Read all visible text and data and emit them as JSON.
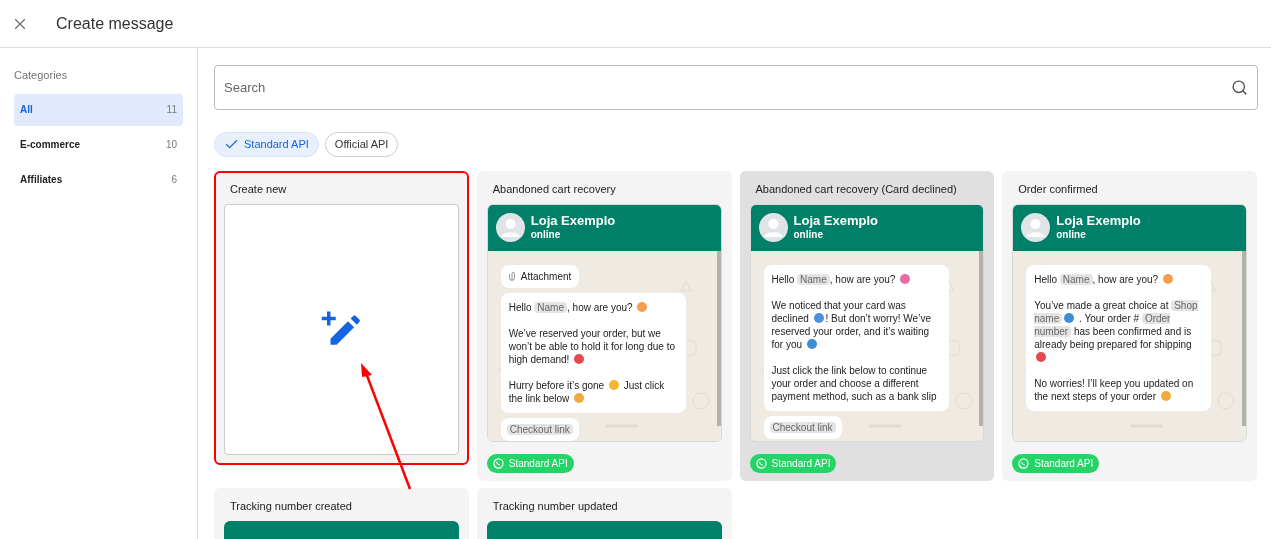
{
  "window": {
    "title": "Create message"
  },
  "sidebar": {
    "heading": "Categories",
    "items": [
      {
        "label": "All",
        "count": "11",
        "selected": true
      },
      {
        "label": "E-commerce",
        "count": "10",
        "selected": false
      },
      {
        "label": "Affiliates",
        "count": "6",
        "selected": false
      }
    ]
  },
  "search": {
    "placeholder": "Search"
  },
  "filters": [
    {
      "label": "Standard API",
      "selected": true
    },
    {
      "label": "Official API",
      "selected": false
    }
  ],
  "cards": [
    {
      "kind": "create",
      "title": "Create new",
      "annotated": true,
      "highlighted": false
    },
    {
      "kind": "template",
      "title": "Abandoned cart recovery",
      "highlighted": false,
      "annotated": false,
      "contact": "Loja Exemplo",
      "status": "online",
      "badge": "Standard API",
      "bubbles": [
        {
          "kind": "attachment",
          "text": "Attachment"
        },
        {
          "kind": "message",
          "paragraphs": [
            [
              {
                "kind": "text",
                "text": "Hello "
              },
              {
                "kind": "chip",
                "text": "Name"
              },
              {
                "kind": "text",
                "text": ", how are you? "
              },
              {
                "kind": "emoji",
                "color": "#f59e52"
              }
            ],
            [
              {
                "kind": "text",
                "text": "We’ve reserved your order, but we won’t be able to hold it for long due to high demand! "
              },
              {
                "kind": "emoji",
                "color": "#e5484d"
              }
            ],
            [
              {
                "kind": "text",
                "text": "Hurry before it’s gone "
              },
              {
                "kind": "emoji",
                "color": "#f2b632"
              },
              {
                "kind": "text",
                "text": " Just click the link below "
              },
              {
                "kind": "emoji",
                "color": "#f2a93b"
              }
            ]
          ]
        },
        {
          "kind": "link",
          "text": "Checkout link"
        }
      ]
    },
    {
      "kind": "template",
      "title": "Abandoned cart recovery (Card declined)",
      "highlighted": true,
      "annotated": false,
      "contact": "Loja Exemplo",
      "status": "online",
      "badge": "Standard API",
      "bubbles": [
        {
          "kind": "message",
          "paragraphs": [
            [
              {
                "kind": "text",
                "text": "Hello "
              },
              {
                "kind": "chip",
                "text": "Name"
              },
              {
                "kind": "text",
                "text": ", how are you? "
              },
              {
                "kind": "emoji",
                "color": "#e86aa8"
              }
            ],
            [
              {
                "kind": "text",
                "text": "We noticed that your card was declined "
              },
              {
                "kind": "emoji",
                "color": "#4f8fe0"
              },
              {
                "kind": "text",
                "text": "! But don’t worry! We’ve reserved your order, and it’s waiting for you "
              },
              {
                "kind": "emoji",
                "color": "#3b8fd9"
              }
            ],
            [
              {
                "kind": "text",
                "text": "Just click the link below to continue your order and choose a different payment method, such as a bank slip"
              }
            ]
          ]
        },
        {
          "kind": "link",
          "text": "Checkout link"
        }
      ]
    },
    {
      "kind": "template",
      "title": "Order confirmed",
      "highlighted": false,
      "annotated": false,
      "contact": "Loja Exemplo",
      "status": "online",
      "badge": "Standard API",
      "bubbles": [
        {
          "kind": "message",
          "paragraphs": [
            [
              {
                "kind": "text",
                "text": "Hello "
              },
              {
                "kind": "chip",
                "text": "Name"
              },
              {
                "kind": "text",
                "text": ", how are you? "
              },
              {
                "kind": "emoji",
                "color": "#f59e52"
              }
            ],
            [
              {
                "kind": "text",
                "text": "You’ve made a great choice at "
              },
              {
                "kind": "chip",
                "text": "Shop name"
              },
              {
                "kind": "emoji",
                "color": "#3b8fd9"
              },
              {
                "kind": "text",
                "text": " . Your order # "
              },
              {
                "kind": "chip",
                "text": "Order number"
              },
              {
                "kind": "text",
                "text": " has been confirmed and is already being prepared for shipping "
              },
              {
                "kind": "emoji",
                "color": "#e5484d"
              }
            ],
            [
              {
                "kind": "text",
                "text": "No worries! I’ll keep you updated on the next steps of your order "
              },
              {
                "kind": "emoji",
                "color": "#f2a93b"
              }
            ]
          ]
        }
      ]
    },
    {
      "kind": "partial",
      "title": "Tracking number created",
      "highlighted": false,
      "annotated": false
    },
    {
      "kind": "partial",
      "title": "Tracking number updated",
      "highlighted": false,
      "annotated": false
    }
  ]
}
